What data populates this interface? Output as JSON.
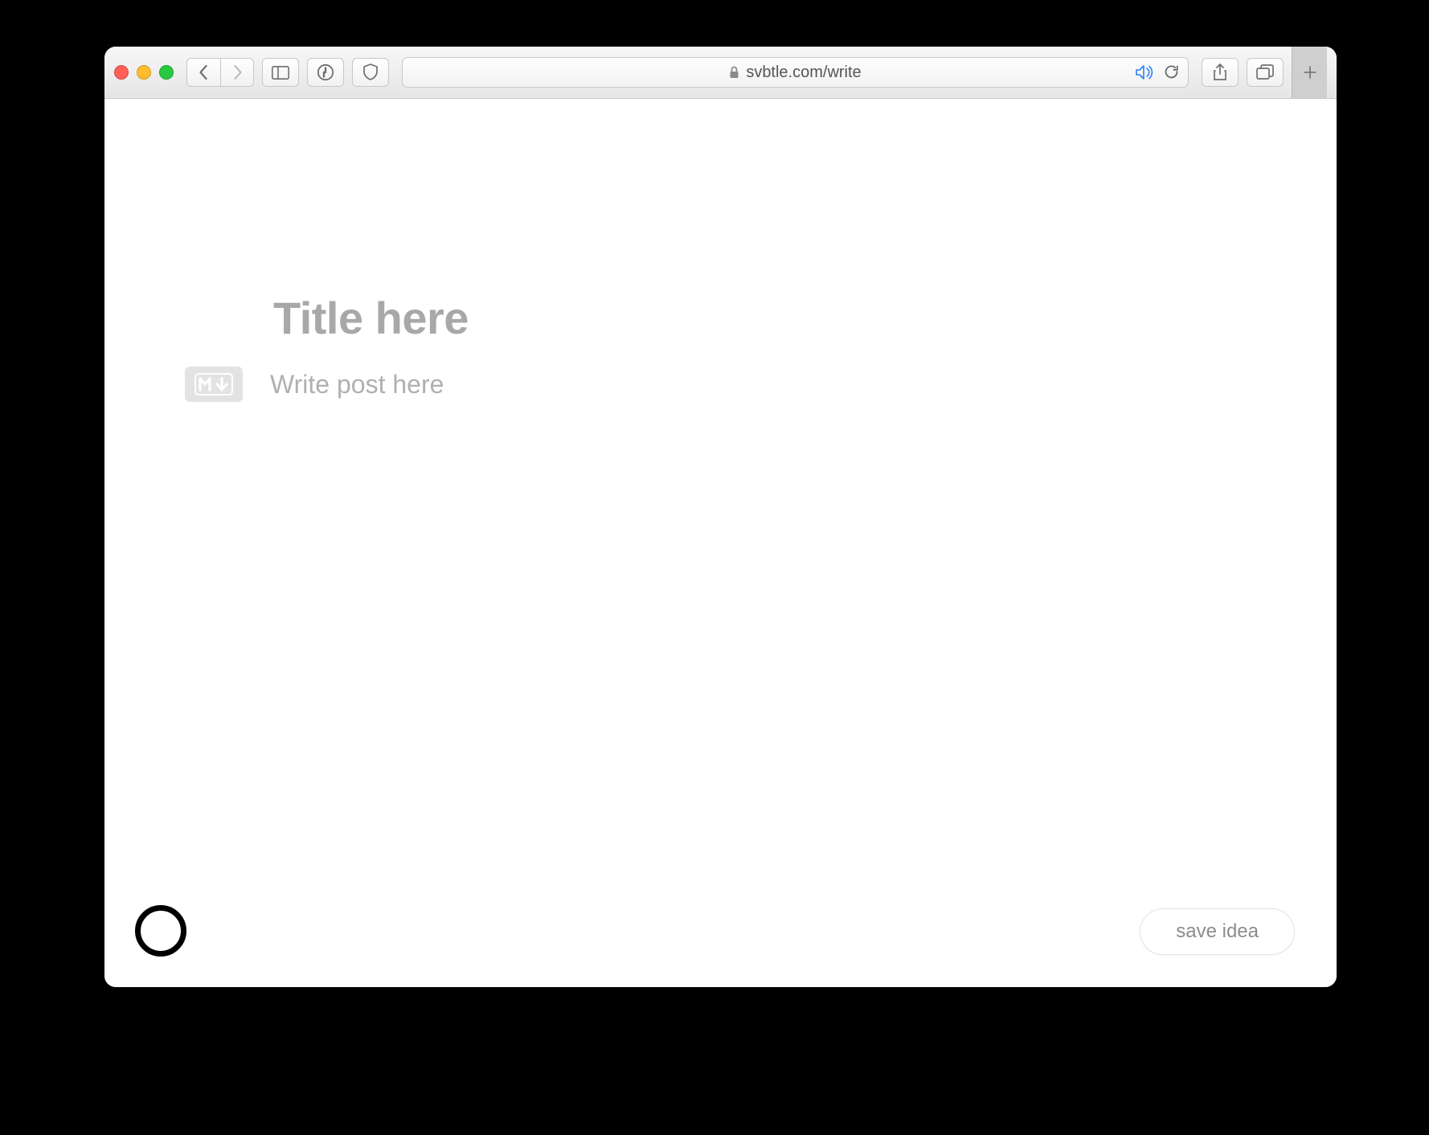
{
  "browser": {
    "url": "svbtle.com/write"
  },
  "editor": {
    "title_placeholder": "Title here",
    "body_placeholder": "Write post here",
    "markdown_label": "M↓"
  },
  "actions": {
    "save_label": "save idea"
  }
}
